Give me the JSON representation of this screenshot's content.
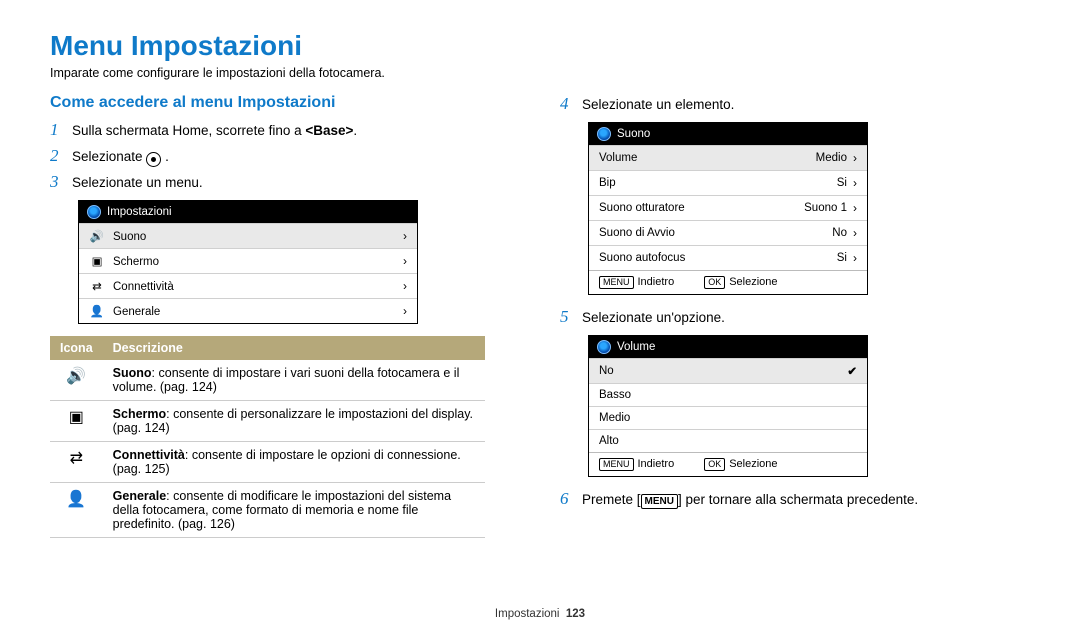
{
  "title": "Menu Impostazioni",
  "intro": "Imparate come configurare le impostazioni della fotocamera.",
  "left": {
    "heading": "Come accedere al menu Impostazioni",
    "step1_pre": "Sulla schermata Home, scorrete fino a ",
    "step1_bold": "<Base>",
    "step1_post": ".",
    "step2_pre": "Selezionate ",
    "step2_post": ".",
    "step3": "Selezionate un menu.",
    "menuTitle": "Impostazioni",
    "menuItems": [
      "Suono",
      "Schermo",
      "Connettività",
      "Generale"
    ],
    "table": {
      "h1": "Icona",
      "h2": "Descrizione",
      "r1": "Suono",
      "r1b": ": consente di impostare i vari suoni della fotocamera e il volume. (pag. 124)",
      "r2": "Schermo",
      "r2b": ": consente di personalizzare le impostazioni del display. (pag. 124)",
      "r3": "Connettività",
      "r3b": ": consente di impostare le opzioni di connessione. (pag. 125)",
      "r4": "Generale",
      "r4b": ": consente di modificare le impostazioni del sistema della fotocamera, come formato di memoria e nome file predefinito. (pag. 126)"
    }
  },
  "right": {
    "step4": "Selezionate un elemento.",
    "soundTitle": "Suono",
    "rows": [
      {
        "k": "Volume",
        "v": "Medio"
      },
      {
        "k": "Bip",
        "v": "Si"
      },
      {
        "k": "Suono otturatore",
        "v": "Suono 1"
      },
      {
        "k": "Suono di Avvio",
        "v": "No"
      },
      {
        "k": "Suono autofocus",
        "v": "Si"
      }
    ],
    "footBack": "Indietro",
    "footSel": "Selezione",
    "step5": "Selezionate un'opzione.",
    "volTitle": "Volume",
    "volOpts": [
      "No",
      "Basso",
      "Medio",
      "Alto"
    ],
    "step6_pre": "Premete [",
    "step6_btn": "MENU",
    "step6_post": "] per tornare alla schermata precedente."
  },
  "footer": {
    "section": "Impostazioni",
    "page": "123"
  },
  "labels": {
    "menuPill": "MENU",
    "okPill": "OK"
  }
}
